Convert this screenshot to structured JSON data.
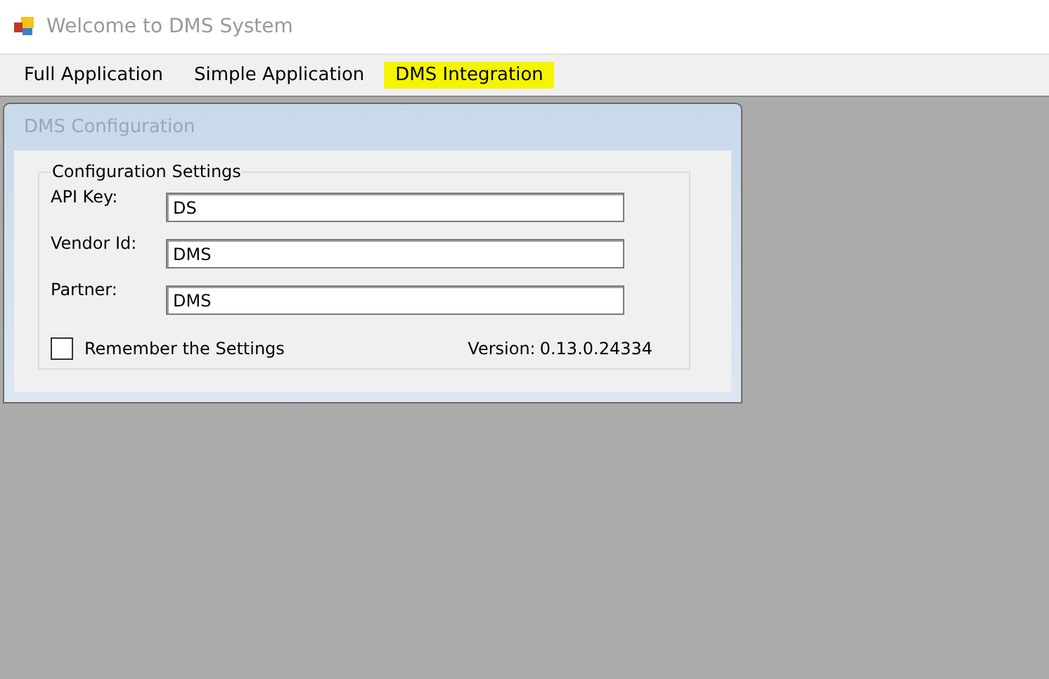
{
  "window": {
    "title": "Welcome to DMS System"
  },
  "menu": [
    {
      "label": "Full Application",
      "selected": false
    },
    {
      "label": "Simple Application",
      "selected": false
    },
    {
      "label": "DMS Integration",
      "selected": true
    }
  ],
  "child_window": {
    "title": "DMS Configuration",
    "group": {
      "title": "Configuration Settings",
      "fields": [
        {
          "label": "API Key:",
          "value": "DS"
        },
        {
          "label": "Vendor Id:",
          "value": "DMS"
        },
        {
          "label": "Partner:",
          "value": "DMS"
        }
      ],
      "remember": {
        "label": "Remember the Settings",
        "checked": false
      },
      "version_label": "Version:",
      "version": "0.13.0.24334"
    }
  }
}
